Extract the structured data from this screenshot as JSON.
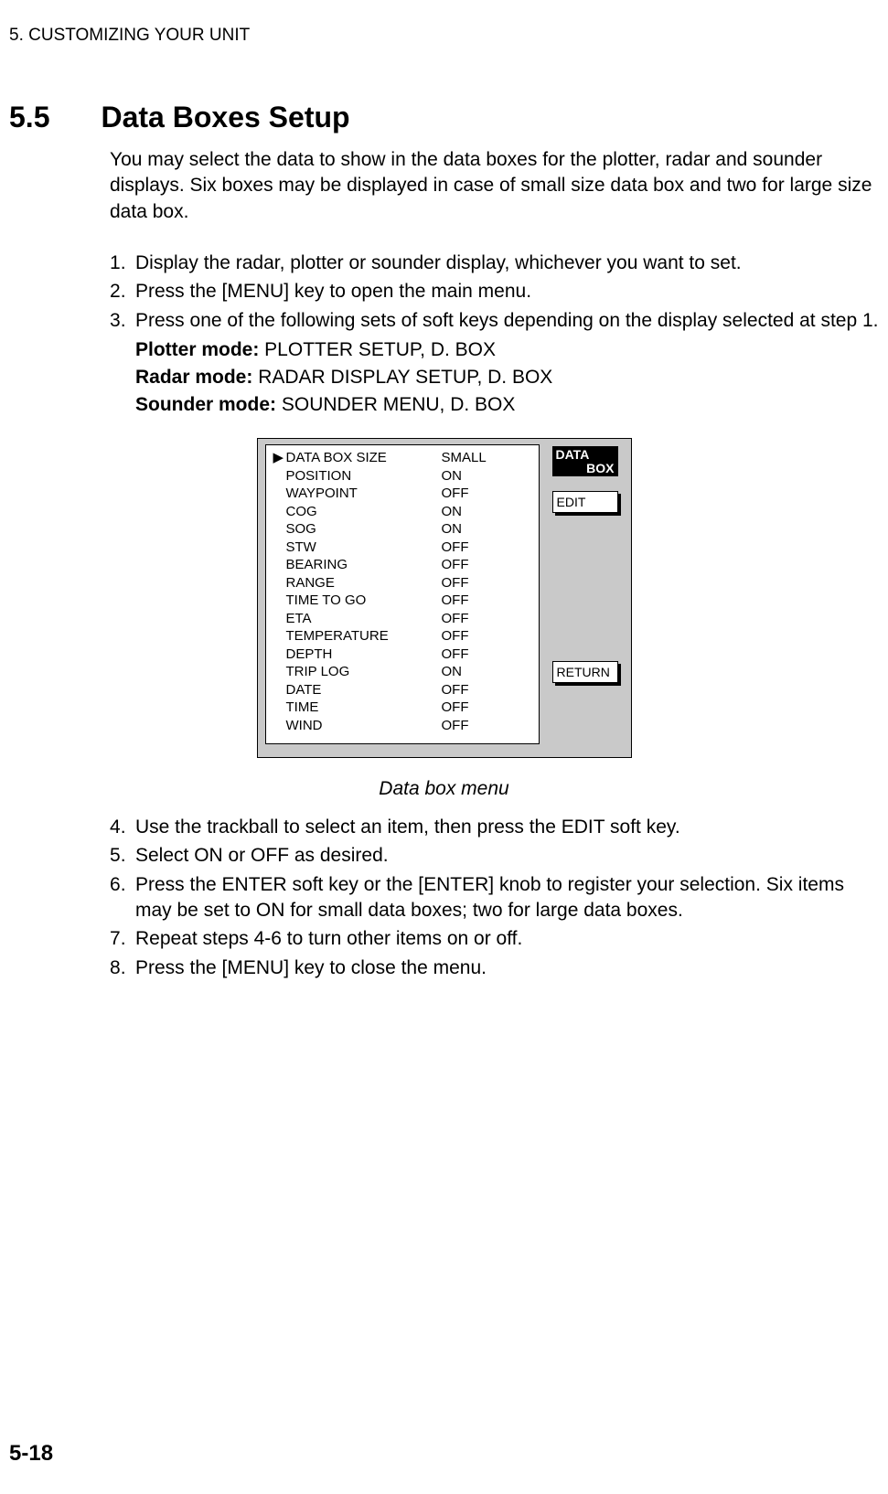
{
  "header": "5. CUSTOMIZING YOUR UNIT",
  "section_num": "5.5",
  "section_title": "Data Boxes Setup",
  "intro": "You may select the data to show in the data boxes for the plotter, radar and sounder displays. Six boxes may be displayed in case of small size data box and two for large size data box.",
  "steps_a": [
    "Display the radar, plotter or sounder display, whichever you want to set.",
    "Press the [MENU] key to open the main menu.",
    "Press one of the following sets of soft keys depending on the display selected at step 1."
  ],
  "modes": [
    {
      "label": "Plotter mode:",
      "value": " PLOTTER SETUP, D. BOX"
    },
    {
      "label": "Radar mode:",
      "value": " RADAR DISPLAY SETUP, D. BOX"
    },
    {
      "label": "Sounder mode:",
      "value": " SOUNDER MENU, D. BOX"
    }
  ],
  "menu": {
    "title_l1": "DATA",
    "title_l2": "BOX",
    "softkey_edit": "EDIT",
    "softkey_return": "RETURN",
    "selector": "▶",
    "rows": [
      {
        "label": "DATA BOX SIZE",
        "value": "SMALL",
        "selected": true
      },
      {
        "label": "POSITION",
        "value": "ON"
      },
      {
        "label": "WAYPOINT",
        "value": "OFF"
      },
      {
        "label": "COG",
        "value": "ON"
      },
      {
        "label": "SOG",
        "value": "ON"
      },
      {
        "label": "STW",
        "value": "OFF"
      },
      {
        "label": "BEARING",
        "value": "OFF"
      },
      {
        "label": "RANGE",
        "value": "OFF"
      },
      {
        "label": "TIME TO GO",
        "value": "OFF"
      },
      {
        "label": "ETA",
        "value": "OFF"
      },
      {
        "label": "TEMPERATURE",
        "value": "OFF"
      },
      {
        "label": "DEPTH",
        "value": "OFF"
      },
      {
        "label": "TRIP LOG",
        "value": "ON"
      },
      {
        "label": "DATE",
        "value": "OFF"
      },
      {
        "label": "TIME",
        "value": "OFF"
      },
      {
        "label": "WIND",
        "value": "OFF"
      }
    ]
  },
  "caption": "Data box menu",
  "steps_b": [
    "Use the trackball to select an item, then press the EDIT soft key.",
    "Select ON or OFF as desired.",
    "Press the ENTER soft key or the [ENTER] knob to register your selection. Six items may be set to ON for small data boxes; two for large data boxes.",
    "Repeat steps 4-6 to turn other items on or off.",
    "Press the [MENU] key to close the menu."
  ],
  "page_num": "5-18"
}
